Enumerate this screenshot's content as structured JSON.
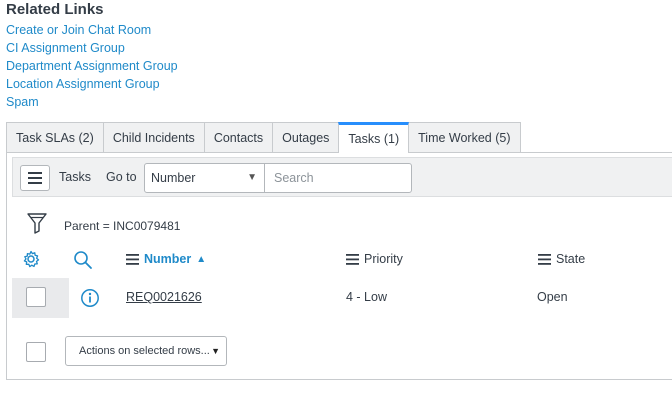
{
  "related_links": {
    "title": "Related Links",
    "links": [
      {
        "label": "Create or Join Chat Room"
      },
      {
        "label": "CI Assignment Group"
      },
      {
        "label": "Department Assignment Group"
      },
      {
        "label": "Location Assignment Group"
      },
      {
        "label": "Spam"
      }
    ]
  },
  "tabs": [
    {
      "label": "Task SLAs (2)"
    },
    {
      "label": "Child Incidents"
    },
    {
      "label": "Contacts"
    },
    {
      "label": "Outages"
    },
    {
      "label": "Tasks (1)",
      "active": true
    },
    {
      "label": "Time Worked (5)"
    }
  ],
  "toolbar": {
    "list_title": "Tasks",
    "goto_label": "Go to",
    "goto_field": "Number",
    "search_placeholder": "Search"
  },
  "filter": {
    "breadcrumb": "Parent = INC0079481"
  },
  "columns": [
    {
      "label": "Number",
      "sorted": "ascending",
      "sort_glyph": "▲"
    },
    {
      "label": "Priority"
    },
    {
      "label": "State"
    }
  ],
  "rows": [
    {
      "number": "REQ0021626",
      "priority": "4 - Low",
      "state": "Open"
    }
  ],
  "actions": {
    "label": "Actions on selected rows...",
    "caret": "▼"
  },
  "colors": {
    "accent": "#278efc",
    "link": "#1f8ac9",
    "text": "#343d47"
  }
}
